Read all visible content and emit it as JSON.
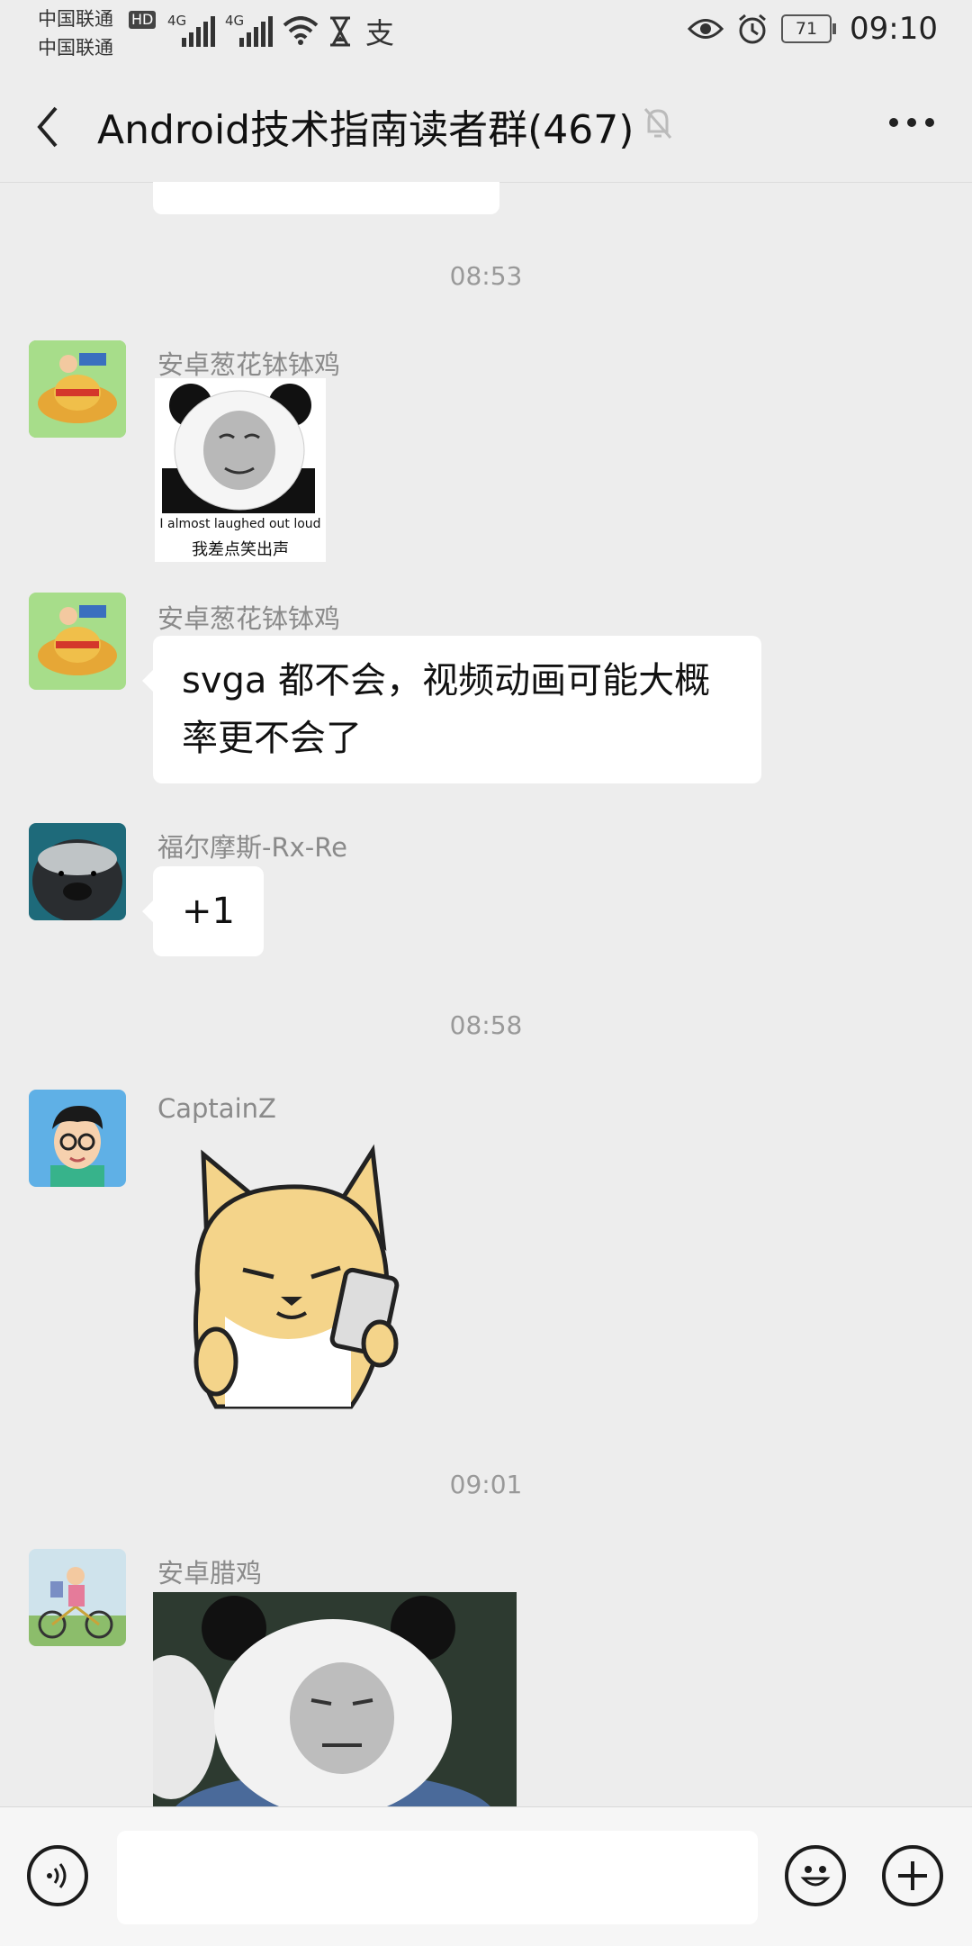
{
  "status_bar": {
    "carrier1": "中国联通",
    "carrier2": "中国联通",
    "hd": "HD",
    "net1": "4G",
    "net2": "4G",
    "battery": "71",
    "time": "09:10"
  },
  "header": {
    "back_icon": "chevron-left-icon",
    "title": "Android技术指南读者群(467)",
    "mute_icon": "bell-off-icon",
    "more_icon": "more-dots-icon"
  },
  "chat": {
    "timestamps": [
      "08:53",
      "08:58",
      "09:01"
    ],
    "messages": [
      {
        "sender": "安卓葱花钵钵鸡",
        "type": "sticker",
        "sticker_caption_en": "I almost laughed out loud",
        "sticker_caption_cn": "我差点笑出声"
      },
      {
        "sender": "安卓葱花钵钵鸡",
        "type": "text",
        "text_line1": "svga 都不会，视频动画可能大概",
        "text_line2": "率更不会了"
      },
      {
        "sender": "福尔摩斯-Rx-Re",
        "type": "text",
        "text": "+1"
      },
      {
        "sender": "CaptainZ",
        "type": "sticker"
      },
      {
        "sender": "安卓腊鸡",
        "type": "sticker"
      }
    ]
  },
  "input_bar": {
    "voice_icon": "voice-icon",
    "input_value": "",
    "emoji_icon": "emoji-icon",
    "plus_icon": "plus-icon"
  },
  "colors": {
    "background": "#ededed",
    "bubble": "#ffffff",
    "timestamp": "#999999",
    "nickname": "#8a8a8a"
  }
}
